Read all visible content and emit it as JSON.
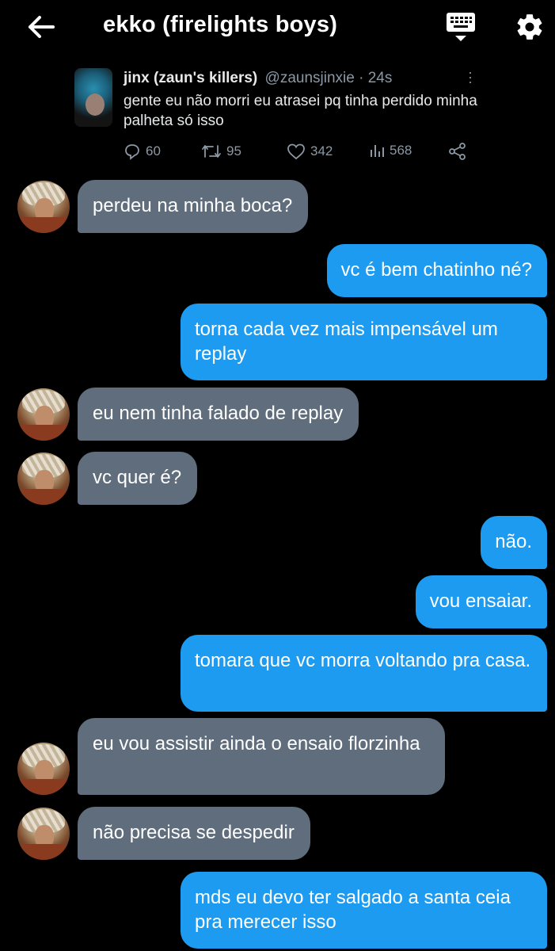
{
  "header": {
    "title": "ekko (firelights boys)"
  },
  "tweet": {
    "name": "jinx (zaun's killers)",
    "handle": "@zaunsjinxie · 24s",
    "text": "gente eu não morri eu atrasei pq tinha perdido minha palheta só isso",
    "replies": "60",
    "retweets": "95",
    "likes": "342",
    "views": "568"
  },
  "messages": [
    {
      "dir": "in",
      "text": "perdeu na minha boca?"
    },
    {
      "dir": "out",
      "text": "vc é bem chatinho né?"
    },
    {
      "dir": "out",
      "text": "torna cada vez mais impensável um replay"
    },
    {
      "dir": "in",
      "text": "eu nem tinha falado de replay"
    },
    {
      "dir": "in",
      "text": "vc quer é?"
    },
    {
      "dir": "out",
      "text": "não."
    },
    {
      "dir": "out",
      "text": "vou ensaiar."
    },
    {
      "dir": "out",
      "text": "tomara que vc morra voltando pra casa."
    },
    {
      "dir": "in",
      "text": "eu vou assistir ainda o ensaio florzinha"
    },
    {
      "dir": "in",
      "text": "não precisa se despedir"
    },
    {
      "dir": "out",
      "text": "mds eu devo ter salgado a santa ceia pra merecer isso"
    }
  ],
  "colors": {
    "background": "#000000",
    "incoming_bubble": "#5f6d7c",
    "outgoing_bubble": "#1d9bf0",
    "muted_text": "#8b98a5"
  },
  "icons": {
    "back": "arrow-left-icon",
    "keyboard": "keyboard-icon",
    "settings": "gear-icon",
    "reply": "reply-icon",
    "retweet": "retweet-icon",
    "like": "heart-icon",
    "views": "views-icon",
    "share": "share-icon",
    "more": "more-vertical-icon"
  }
}
